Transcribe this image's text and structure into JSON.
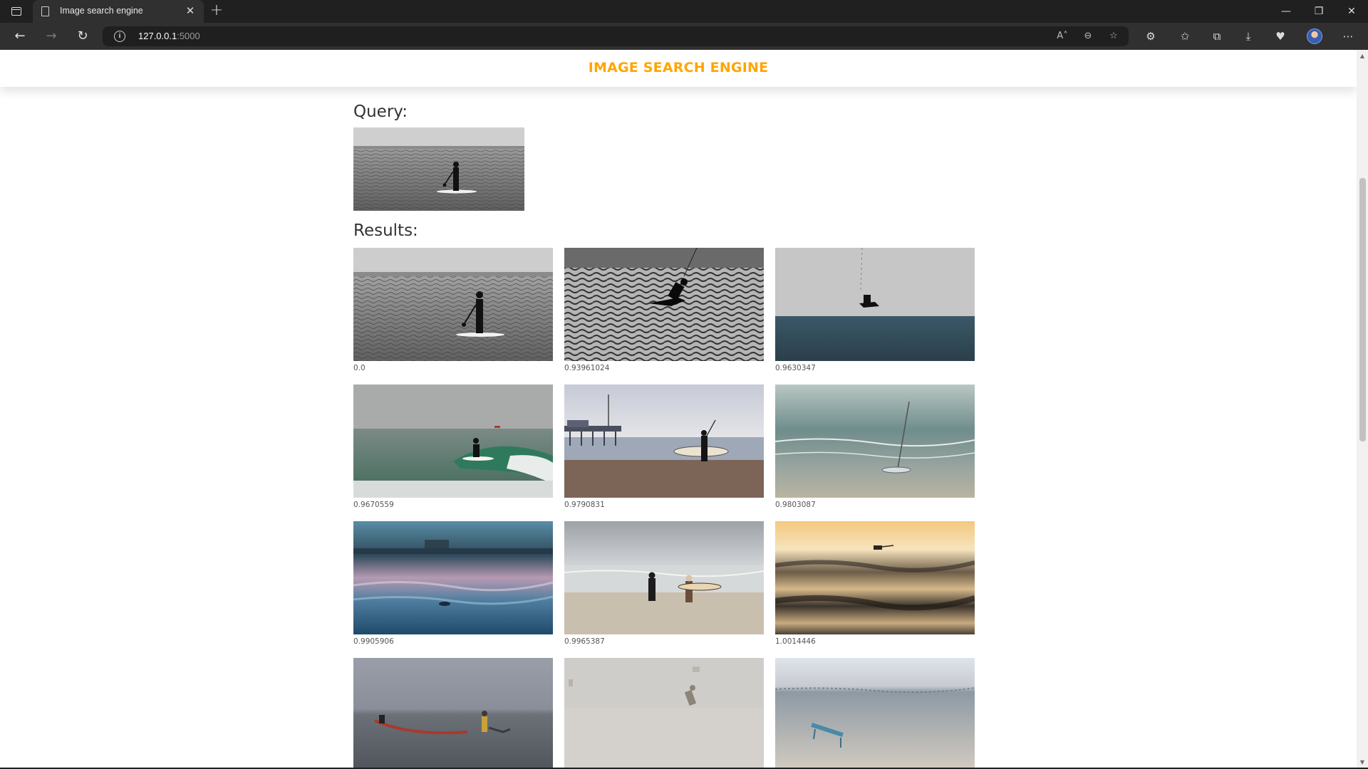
{
  "browser": {
    "tab_title": "Image search engine",
    "tab_close": "✕",
    "new_tab": "+",
    "url_host": "127.0.0.1",
    "url_port": ":5000",
    "window": {
      "minimize": "—",
      "restore": "❐",
      "close": "✕"
    },
    "nav": {
      "back": "←",
      "forward": "→",
      "reload": "↻"
    },
    "address_icons": {
      "read_aloud": "A˄",
      "zoom": "⊖",
      "favorite": "☆"
    },
    "toolbar_icons": {
      "extensions": "⚙",
      "favorites": "✩",
      "collections": "⧉",
      "downloads": "⤓",
      "health": "♥",
      "menu": "⋯"
    }
  },
  "page": {
    "title": "IMAGE SEARCH ENGINE",
    "title_color": "#ffa500",
    "query_label": "Query:",
    "results_label": "Results:",
    "query_image": "grayscale-paddleboarder-on-calm-sea",
    "results": [
      {
        "image": "grayscale-paddleboarder",
        "score": "0.0"
      },
      {
        "image": "grayscale-kitesurfer-on-waves",
        "score": "0.93961024"
      },
      {
        "image": "kitesurfer-airborne-over-sea",
        "score": "0.9630347"
      },
      {
        "image": "surfer-riding-green-wave",
        "score": "0.9670559"
      },
      {
        "image": "surfer-with-board-near-pier",
        "score": "0.9790831"
      },
      {
        "image": "windsurf-board-on-beach",
        "score": "0.9803087"
      },
      {
        "image": "blurred-sea-with-pier-at-dusk",
        "score": "0.9905906"
      },
      {
        "image": "two-surfers-walking-on-beach",
        "score": "0.9965387"
      },
      {
        "image": "surfer-at-sunset-waves",
        "score": "1.0014446"
      },
      {
        "image": "person-pulling-boat-in-sea",
        "score": ""
      },
      {
        "image": "skier-in-fog",
        "score": ""
      },
      {
        "image": "bench-on-sandy-beach",
        "score": ""
      }
    ]
  }
}
